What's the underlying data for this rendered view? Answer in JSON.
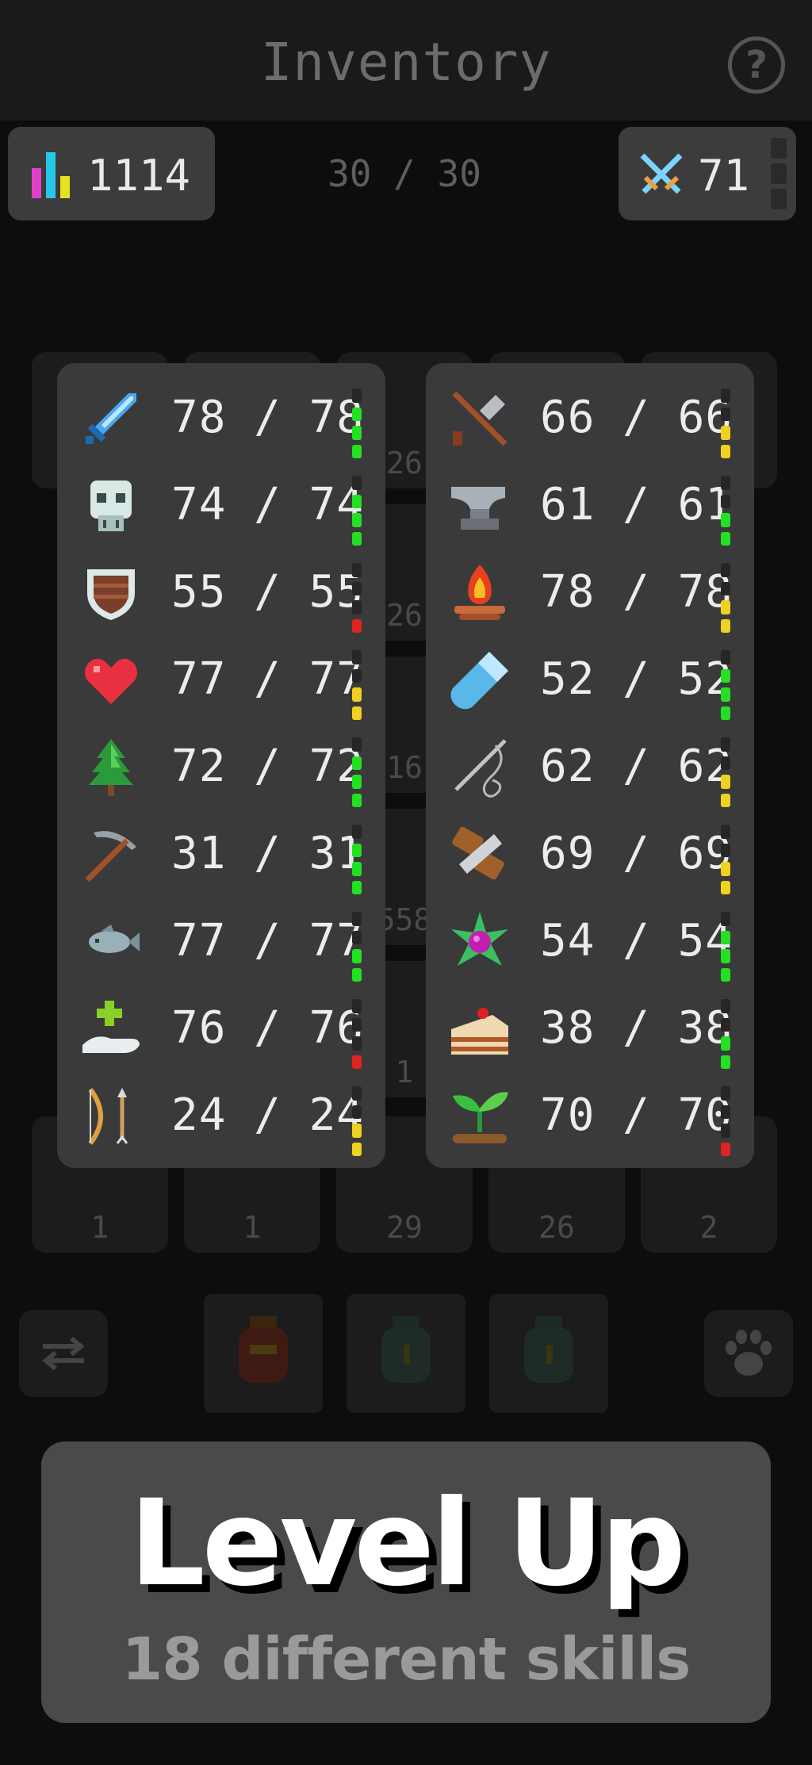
{
  "header": {
    "title": "Inventory",
    "help_label": "?"
  },
  "stats_pill": {
    "value": "1114",
    "icon": "bar-chart-icon"
  },
  "combat_pill": {
    "value": "71",
    "icon": "crossed-swords-icon"
  },
  "capacity": "30 / 30",
  "background_counts": [
    "26",
    "26",
    "16",
    "558",
    "1",
    "1",
    "1",
    "29",
    "26",
    "2"
  ],
  "skills_left": [
    {
      "icon": "sword-icon",
      "level": "78 / 78",
      "bar": [
        "#23e023",
        "#23e023",
        "#23e023"
      ],
      "empty": 1
    },
    {
      "icon": "skull-helmet-icon",
      "level": "74 / 74",
      "bar": [
        "#23e023",
        "#23e023",
        "#23e023"
      ],
      "empty": 1
    },
    {
      "icon": "shield-icon",
      "level": "55 / 55",
      "bar": [
        "#e02323"
      ],
      "empty": 3
    },
    {
      "icon": "heart-icon",
      "level": "77 / 77",
      "bar": [
        "#f0d020",
        "#f0d020"
      ],
      "empty": 2
    },
    {
      "icon": "tree-icon",
      "level": "72 / 72",
      "bar": [
        "#23e023",
        "#23e023",
        "#23e023"
      ],
      "empty": 1
    },
    {
      "icon": "pickaxe-icon",
      "level": "31 / 31",
      "bar": [
        "#23e023",
        "#23e023",
        "#23e023"
      ],
      "empty": 1
    },
    {
      "icon": "fish-icon",
      "level": "77 / 77",
      "bar": [
        "#23e023",
        "#23e023"
      ],
      "empty": 2
    },
    {
      "icon": "healing-hand-icon",
      "level": "76 / 76",
      "bar": [
        "#e02323"
      ],
      "empty": 3
    },
    {
      "icon": "bow-icon",
      "level": "24 / 24",
      "bar": [
        "#f0d020",
        "#f0d020"
      ],
      "empty": 2
    }
  ],
  "skills_right": [
    {
      "icon": "hammer-icon",
      "level": "66 / 66",
      "bar": [
        "#f0d020",
        "#f0d020"
      ],
      "empty": 2
    },
    {
      "icon": "anvil-icon",
      "level": "61 / 61",
      "bar": [
        "#23e023",
        "#23e023"
      ],
      "empty": 2
    },
    {
      "icon": "campfire-icon",
      "level": "78 / 78",
      "bar": [
        "#f0d020",
        "#f0d020"
      ],
      "empty": 2
    },
    {
      "icon": "potion-vial-icon",
      "level": "52 / 52",
      "bar": [
        "#23e023",
        "#23e023",
        "#23e023"
      ],
      "empty": 1
    },
    {
      "icon": "needle-thread-icon",
      "level": "62 / 62",
      "bar": [
        "#f0d020",
        "#f0d020"
      ],
      "empty": 2
    },
    {
      "icon": "saw-log-icon",
      "level": "69 / 69",
      "bar": [
        "#f0d020",
        "#f0d020"
      ],
      "empty": 2
    },
    {
      "icon": "magic-gem-icon",
      "level": "54 / 54",
      "bar": [
        "#23e023",
        "#23e023",
        "#23e023"
      ],
      "empty": 1
    },
    {
      "icon": "cake-icon",
      "level": "38 / 38",
      "bar": [
        "#23e023",
        "#23e023"
      ],
      "empty": 2
    },
    {
      "icon": "sprout-icon",
      "level": "70 / 70",
      "bar": [
        "#e02323"
      ],
      "empty": 3
    }
  ],
  "promo": {
    "title": "Level Up",
    "subtitle": "18 different skills"
  },
  "colors": {
    "green": "#23e023",
    "yellow": "#f0d020",
    "red": "#e02323",
    "panel": "#3a3a3a",
    "promo": "#4a4a4a"
  }
}
